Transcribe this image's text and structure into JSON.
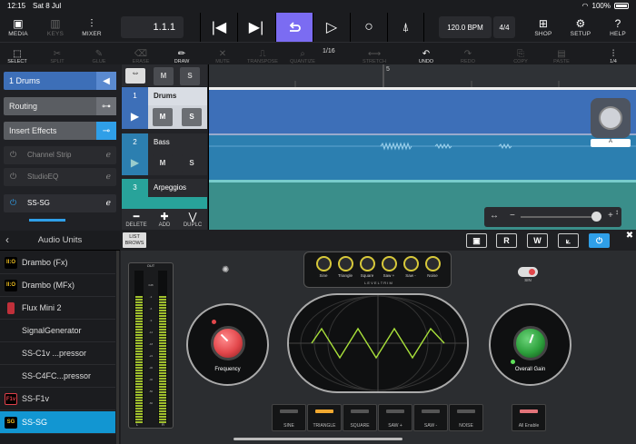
{
  "status": {
    "time": "12:15",
    "date": "Sat 8 Jul",
    "battery": "100%"
  },
  "toolbar": {
    "media": "MEDIA",
    "keys": "KEYS",
    "mixer": "MIXER",
    "position": "1.1.1",
    "tempo": "120.0 BPM",
    "time_signature": "4/4",
    "shop": "SHOP",
    "setup": "SETUP",
    "help": "HELP"
  },
  "edit": {
    "select": "SELECT",
    "split": "SPLIT",
    "glue": "GLUE",
    "erase": "ERASE",
    "draw": "DRAW",
    "mute": "MUTE",
    "transpose": "TRANSPOSE",
    "quantize": "QUANTIZE",
    "quantize_value": "1/16",
    "stretch": "STRETCH",
    "undo": "UNDO",
    "redo": "REDO",
    "copy": "COPY",
    "paste": "PASTE",
    "snap": "1/4"
  },
  "inspector": {
    "track_label": "1  Drums",
    "routing": "Routing",
    "insert_effects": "Insert Effects",
    "effects": [
      "Channel Strip",
      "StudioEQ",
      "SS-SG"
    ]
  },
  "tracks": [
    {
      "num": "1",
      "name": "Drums",
      "mute": "M",
      "solo": "S"
    },
    {
      "num": "2",
      "name": "Bass",
      "mute": "M",
      "solo": "S"
    },
    {
      "num": "3",
      "name": "Arpeggios",
      "mute": "M",
      "solo": "S"
    }
  ],
  "header_ms": {
    "mute": "M",
    "solo": "S"
  },
  "arrange": {
    "bar_marker": "5",
    "scroll_label": "A"
  },
  "track_actions": {
    "delete": "DELETE",
    "add": "ADD",
    "duplicate": "DUPLC"
  },
  "audio_units": {
    "title": "Audio Units",
    "items": [
      {
        "name": "Drambo (Fx)",
        "logo": "II:O",
        "logo_color": "#f0c020"
      },
      {
        "name": "Drambo (MFx)",
        "logo": "II:O",
        "logo_color": "#f0c020"
      },
      {
        "name": "Flux Mini 2",
        "logo": "",
        "logo_color": "#c0303a"
      },
      {
        "name": "SignalGenerator",
        "logo": "",
        "logo_color": ""
      },
      {
        "name": "SS-C1v ...pressor",
        "logo": "",
        "logo_color": ""
      },
      {
        "name": "SS-C4FC...pressor",
        "logo": "",
        "logo_color": ""
      },
      {
        "name": "SS-F1v",
        "logo": "F1v",
        "logo_color": "#c0303a"
      },
      {
        "name": "SS-SG",
        "logo": "SG",
        "logo_color": "#f0c020"
      }
    ]
  },
  "plugin": {
    "list_browse": "LIST BROWS",
    "header_buttons": [
      "R",
      "W"
    ],
    "mixer_knobs": [
      "Sine",
      "Triangle",
      "Square",
      "Saw +",
      "Saw -",
      "Noise"
    ],
    "level_trim": "L E V E L   T R I M",
    "sin_label": "SIN",
    "frequency_label": "Frequency",
    "overall_gain_label": "Overall Gain",
    "meter_label": "OUT",
    "meter_l": "L",
    "meter_r": "R",
    "meter_scale": [
      "0dB",
      "-3",
      "-6",
      "-9",
      "-12",
      "-18",
      "-24",
      "-30",
      "-40",
      "-50",
      "-60"
    ],
    "wave_buttons": [
      "SINE",
      "TRIANGLE",
      "SQUARE",
      "SAW +",
      "SAW -",
      "NOISE"
    ],
    "active_wave": "TRIANGLE",
    "all_enable": "All Enable"
  },
  "colors": {
    "accent": "#7b6cf2",
    "track_blue": "#3d6fb8",
    "selected": "#1296d2",
    "wave_green": "#a8e03a",
    "knob_red": "#e2474b",
    "knob_green": "#2da03c",
    "knob_yellow": "#d7c83a"
  }
}
